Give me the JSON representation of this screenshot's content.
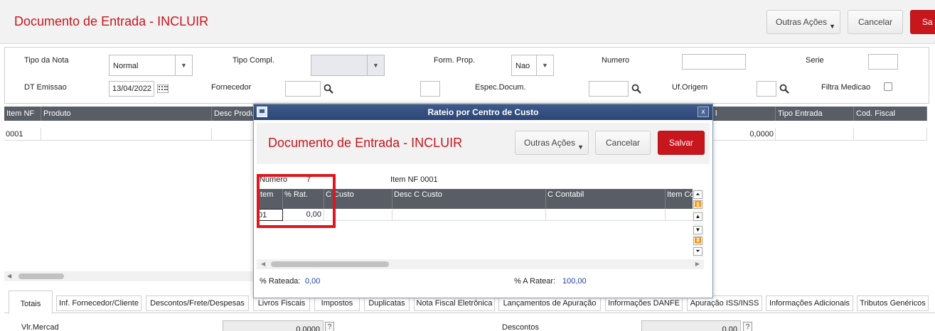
{
  "header": {
    "title": "Documento de Entrada - INCLUIR",
    "outras_acoes": "Outras Ações",
    "cancelar": "Cancelar",
    "salvar": "Sa"
  },
  "form": {
    "tipo_nota_label": "Tipo da Nota",
    "tipo_nota_value": "Normal",
    "tipo_compl_label": "Tipo Compl.",
    "form_prop_label": "Form. Prop.",
    "form_prop_value": "Nao",
    "numero_label": "Numero",
    "serie_label": "Serie",
    "dt_emissao_label": "DT Emissao",
    "dt_emissao_value": "13/04/2022",
    "fornecedor_label": "Fornecedor",
    "espec_docum_label": "Espec.Docum.",
    "uf_origem_label": "Uf.Origem",
    "filtra_medicao_label": "Filtra Medicao"
  },
  "grid": {
    "columns": [
      "Item NF",
      "Produto",
      "Desc Produ",
      "l",
      "Tipo Entrada",
      "Cod. Fiscal"
    ],
    "row": [
      "0001",
      "0,0000"
    ]
  },
  "tabs": [
    "Totais",
    "Inf. Fornecedor/Cliente",
    "Descontos/Frete/Despesas",
    "Livros Fiscais",
    "Impostos",
    "Duplicatas",
    "Nota Fiscal Eletrônica",
    "Lançamentos de Apuração",
    "Informações DANFE",
    "Apuração ISS/INSS",
    "Informações Adicionais",
    "Tributos Genéricos"
  ],
  "totals": {
    "vlr_mercad_label": "Vlr.Mercad",
    "vlr_mercad_value": "0,0000",
    "descontos_label": "Descontos",
    "descontos_value": "0,00",
    "help": "?"
  },
  "modal": {
    "window_title": "Rateio por Centro de Custo",
    "close": "x",
    "title": "Documento de Entrada - INCLUIR",
    "outras_acoes": "Outras Ações",
    "cancelar": "Cancelar",
    "salvar": "Salvar",
    "numero_label": "Numero",
    "numero_value": "7",
    "item_nf": "Item NF 0001",
    "columns": [
      "Item",
      "% Rat.",
      "C Custo",
      "Desc C Custo",
      "C Contabil",
      "Item Co"
    ],
    "row": {
      "item": "01",
      "rat": "0,00"
    },
    "rateada_label": "% Rateada:",
    "rateada_value": "0,00",
    "a_ratear_label": "% A Ratear:",
    "a_ratear_value": "100,00"
  }
}
